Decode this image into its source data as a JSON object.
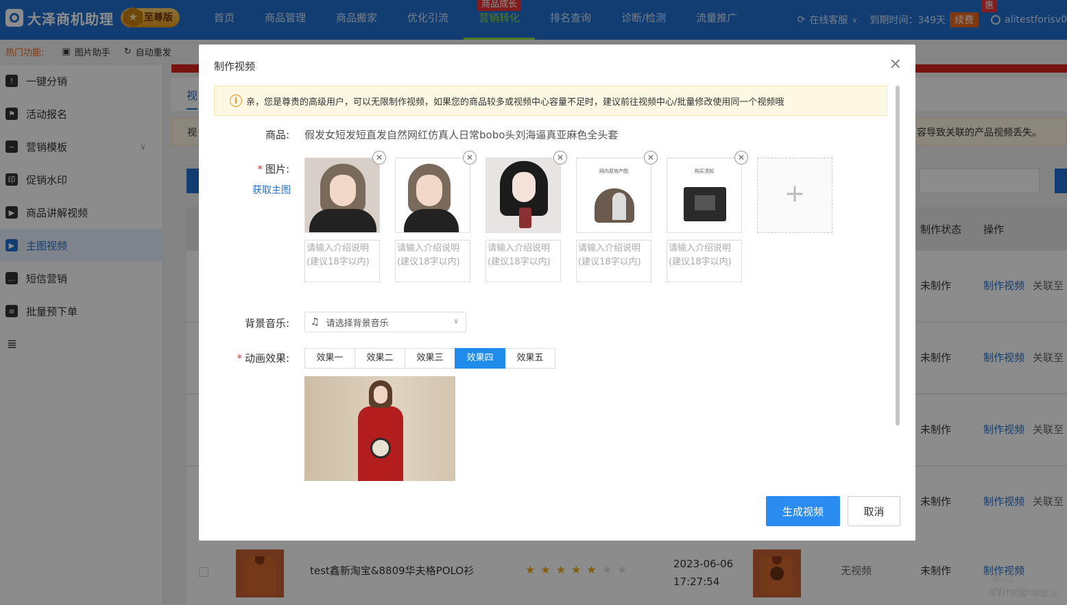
{
  "app": {
    "brand": "大泽商机助理",
    "edition": "至尊版"
  },
  "nav": {
    "items": [
      {
        "label": "首页"
      },
      {
        "label": "商品管理"
      },
      {
        "label": "商品搬家"
      },
      {
        "label": "优化引流"
      },
      {
        "label": "营销转化",
        "tag": "商品成长"
      },
      {
        "label": "排名查询"
      },
      {
        "label": "诊断/检测"
      },
      {
        "label": "流量推广"
      }
    ],
    "active": "营销转化",
    "service": "在线客服",
    "expiry": "到期时间：349天",
    "renew": "续费",
    "renew_tag": "惠",
    "user": "alitestforisv0"
  },
  "hotbar": {
    "label": "热门功能:",
    "items": [
      "图片助手",
      "自动重发"
    ]
  },
  "sidebar": {
    "items": [
      {
        "label": "一键分销",
        "icon": "warning-icon"
      },
      {
        "label": "活动报名",
        "icon": "flag-icon"
      },
      {
        "label": "营销模板",
        "icon": "chart-icon"
      },
      {
        "label": "促销水印",
        "icon": "stamp-icon"
      },
      {
        "label": "商品讲解视频",
        "icon": "camera-icon"
      },
      {
        "label": "主图视频",
        "icon": "video-icon"
      },
      {
        "label": "短信营销",
        "icon": "message-icon"
      },
      {
        "label": "批量预下单",
        "icon": "document-icon"
      }
    ],
    "active": "主图视频"
  },
  "background": {
    "tab": "视",
    "notice_left": "视",
    "notice_right": "容导致关联的产品视频丢失。",
    "table_headers": {
      "status": "制作状态",
      "action": "操作"
    },
    "rows": [
      {
        "status": "未制作",
        "make": "制作视频",
        "link": "关联至"
      },
      {
        "status": "未制作",
        "make": "制作视频",
        "link": "关联至"
      },
      {
        "status": "未制作",
        "make": "制作视频",
        "link": "关联至"
      },
      {
        "status": "未制作",
        "make": "制作视频",
        "link": "关联至"
      }
    ],
    "last_row": {
      "title": "test鑫新淘宝&8809华夫格POLO衫",
      "stars_on": 5,
      "stars_total": 7,
      "date": "2023-06-06",
      "time": "17:27:54",
      "video": "无视频",
      "status": "未制作",
      "make": "制作视频"
    },
    "watermark": {
      "line1": "激活 Windows",
      "line2": "转到\"设置\"以激活"
    }
  },
  "modal": {
    "title": "制作视频",
    "alert": "亲，您是尊贵的高级用户，可以无限制作视频，如果您的商品较多或视频中心容量不足时，建议前往视频中心/批量修改使用同一个视频哦",
    "product_label": "商品:",
    "product_name": "假发女短发短直发自然网红仿真人日常bobo头刘海逼真亚麻色全头套",
    "images_label": "图片:",
    "get_main": "获取主图",
    "desc_placeholder": "请输入介绍说明(建议18字以内)",
    "images": [
      {
        "name": "bob-wig-front"
      },
      {
        "name": "bob-wig-portrait"
      },
      {
        "name": "black-bob-selfie"
      },
      {
        "name": "wig-cap-info",
        "text": "网内原效产图"
      },
      {
        "name": "wig-box-info",
        "text": "购买须知"
      }
    ],
    "music_label": "背景音乐:",
    "music_placeholder": "请选择背景音乐",
    "effect_label": "动画效果:",
    "effects": [
      "效果一",
      "效果二",
      "效果三",
      "效果四",
      "效果五"
    ],
    "active_effect": "效果四",
    "generate": "生成视频",
    "cancel": "取消"
  }
}
